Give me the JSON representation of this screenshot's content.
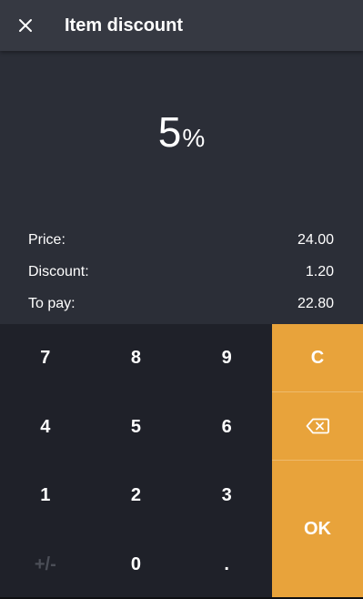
{
  "header": {
    "title": "Item discount",
    "close_icon": "close-icon"
  },
  "display": {
    "value": "5",
    "unit": "%"
  },
  "summary": {
    "price_label": "Price:",
    "price_value": "24.00",
    "discount_label": "Discount:",
    "discount_value": "1.20",
    "topay_label": "To pay:",
    "topay_value": "22.80"
  },
  "keypad": {
    "k7": "7",
    "k8": "8",
    "k9": "9",
    "k4": "4",
    "k5": "5",
    "k6": "6",
    "k1": "1",
    "k2": "2",
    "k3": "3",
    "sign": "+/-",
    "k0": "0",
    "dot": "."
  },
  "actions": {
    "clear_label": "C",
    "backspace_icon": "backspace-icon",
    "ok_label": "OK"
  },
  "colors": {
    "header_bg": "#363942",
    "display_bg": "#2b2e37",
    "keypad_bg": "#1f2129",
    "accent": "#e8a33b",
    "disabled_text": "#4b4e57"
  }
}
